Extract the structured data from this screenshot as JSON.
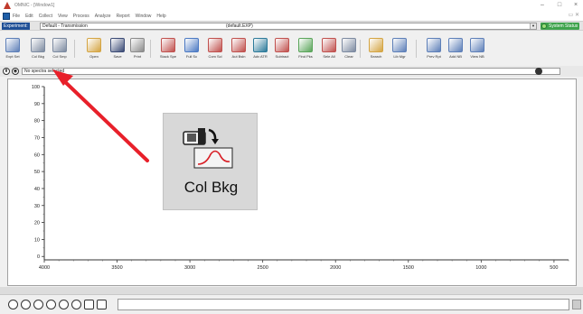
{
  "window": {
    "title": "OMNIC - [Window1]"
  },
  "menubar": {
    "items": [
      "File",
      "Edit",
      "Collect",
      "View",
      "Process",
      "Analyze",
      "Report",
      "Window",
      "Help"
    ]
  },
  "experiment": {
    "label": "Experiment:",
    "name": "Default - Transmission",
    "file": "(default.EXP)",
    "status": "System Status"
  },
  "toolbar": {
    "buttons": [
      {
        "label": "Expt Set",
        "icon": "expt-set-icon",
        "color": "#5d7fb8"
      },
      {
        "label": "Col Bkg",
        "icon": "col-bkg-icon",
        "color": "#7c8aa0"
      },
      {
        "label": "Col Smp",
        "icon": "col-smp-icon",
        "color": "#7c8aa0"
      },
      {
        "label": "Open",
        "icon": "open-icon",
        "color": "#d4a442"
      },
      {
        "label": "Save",
        "icon": "save-icon",
        "color": "#3a4a75"
      },
      {
        "label": "Print",
        "icon": "print-icon",
        "color": "#8a8a8a"
      },
      {
        "label": "Stack Spe",
        "icon": "stack-spec-icon",
        "color": "#c0504d"
      },
      {
        "label": "Full Sc",
        "icon": "full-scale-icon",
        "color": "#4b79c3"
      },
      {
        "label": "Com Scl",
        "icon": "common-scale-icon",
        "color": "#c0504d"
      },
      {
        "label": "Aut Bsln",
        "icon": "auto-baseline-icon",
        "color": "#c0504d"
      },
      {
        "label": "Adv ATR",
        "icon": "adv-atr-icon",
        "color": "#2c7a9a"
      },
      {
        "label": "Subtract",
        "icon": "subtract-icon",
        "color": "#c0504d"
      },
      {
        "label": "Find Pks",
        "icon": "find-peaks-icon",
        "color": "#5aa55a"
      },
      {
        "label": "Sele All",
        "icon": "select-all-icon",
        "color": "#c0504d"
      },
      {
        "label": "Clear",
        "icon": "clear-icon",
        "color": "#7c8aa0"
      },
      {
        "label": "Search",
        "icon": "search-icon",
        "color": "#d4a442"
      },
      {
        "label": "Lib Mgr",
        "icon": "library-manager-icon",
        "color": "#5d7fb8"
      },
      {
        "label": "Prev Rpt",
        "icon": "preview-report-icon",
        "color": "#5d7fb8"
      },
      {
        "label": "Add NB",
        "icon": "add-notebook-icon",
        "color": "#5d7fb8"
      },
      {
        "label": "View NB",
        "icon": "view-notebook-icon",
        "color": "#5d7fb8"
      }
    ]
  },
  "specbar": {
    "text": "No spectra selected"
  },
  "chart_data": {
    "type": "line",
    "x_ticks": [
      "4000",
      "3500",
      "3000",
      "2500",
      "2000",
      "1500",
      "1000",
      "500"
    ],
    "y_ticks": [
      "100",
      "90",
      "80",
      "70",
      "60",
      "50",
      "40",
      "30",
      "20",
      "10",
      "0"
    ],
    "xlim": [
      4000,
      400
    ],
    "ylim": [
      -2,
      100
    ],
    "series": []
  },
  "zoom": {
    "label": "Col Bkg"
  },
  "colors": {
    "arrow": "#e8202a",
    "accent": "#1f4f96"
  }
}
